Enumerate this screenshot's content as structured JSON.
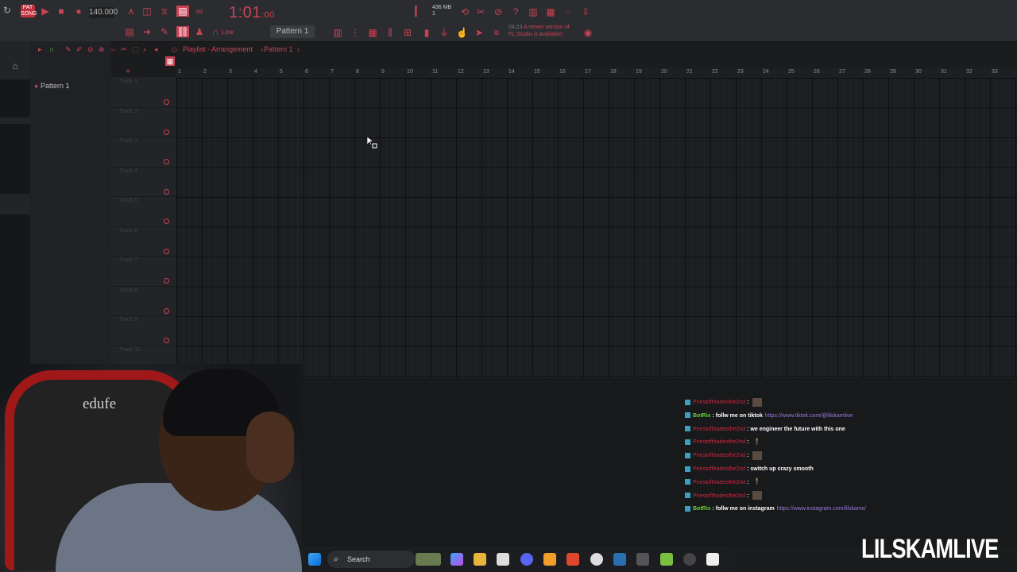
{
  "toolbar": {
    "song_badge": "PAT SONG",
    "tempo": "140.000",
    "time_main": "1:01",
    "time_sub": ":00",
    "memory": "436 MB",
    "memory_sub": "1",
    "pattern_selector": "Pattern 1",
    "snap_label": "Line",
    "update_time": "04:23",
    "update_msg_1": "A newer version of",
    "update_msg_2": "FL Studio is available!"
  },
  "playlist": {
    "breadcrumb_root": "Playlist - Arrangement",
    "breadcrumb_pattern": "Pattern 1",
    "pattern_list": [
      "Pattern 1"
    ],
    "tracks": [
      "Track 1",
      "Track 2",
      "Track 3",
      "Track 4",
      "Track 5",
      "Track 6",
      "Track 7",
      "Track 8",
      "Track 9",
      "Track 10"
    ],
    "ruler": [
      "1",
      "2",
      "3",
      "4",
      "5",
      "6",
      "7",
      "8",
      "9",
      "10",
      "11",
      "12",
      "13",
      "14",
      "15",
      "16",
      "17",
      "18",
      "19",
      "20",
      "21",
      "22",
      "23",
      "24",
      "25",
      "26",
      "27",
      "28",
      "29",
      "30",
      "31",
      "32",
      "33"
    ]
  },
  "webcam": {
    "chair_logo": "edufe"
  },
  "chat": {
    "messages": [
      {
        "user": "Priestofthadesthe2nd",
        "text": "",
        "emote": "img",
        "link": ""
      },
      {
        "user": "BotRix",
        "bot": true,
        "text": "follw me on tiktok",
        "link": "https://www.tiktok.com/@lilskamlive",
        "emote": ""
      },
      {
        "user": "Priestofthadesthe2nd",
        "text": "we engineer the future with this one",
        "emote": "",
        "link": ""
      },
      {
        "user": "Priestofthadesthe2nd",
        "text": "",
        "emote": "person",
        "link": ""
      },
      {
        "user": "Priestofthadesthe2nd",
        "text": "",
        "emote": "img",
        "link": ""
      },
      {
        "user": "Priestofthadesthe2nd",
        "text": "switch up crazy smooth",
        "emote": "",
        "link": ""
      },
      {
        "user": "Priestofthadesthe2nd",
        "text": "",
        "emote": "person",
        "link": ""
      },
      {
        "user": "Priestofthadesthe2nd",
        "text": "",
        "emote": "img",
        "link": ""
      },
      {
        "user": "BotRix",
        "bot": true,
        "text": "follw me on instagram",
        "link": "https://www.instagram.com/lilskamx/",
        "emote": ""
      }
    ]
  },
  "taskbar": {
    "search_label": "Search"
  },
  "watermark": "LILSKAMLIVE",
  "colors": {
    "accent": "#c84455",
    "bg": "#1d1e21"
  }
}
